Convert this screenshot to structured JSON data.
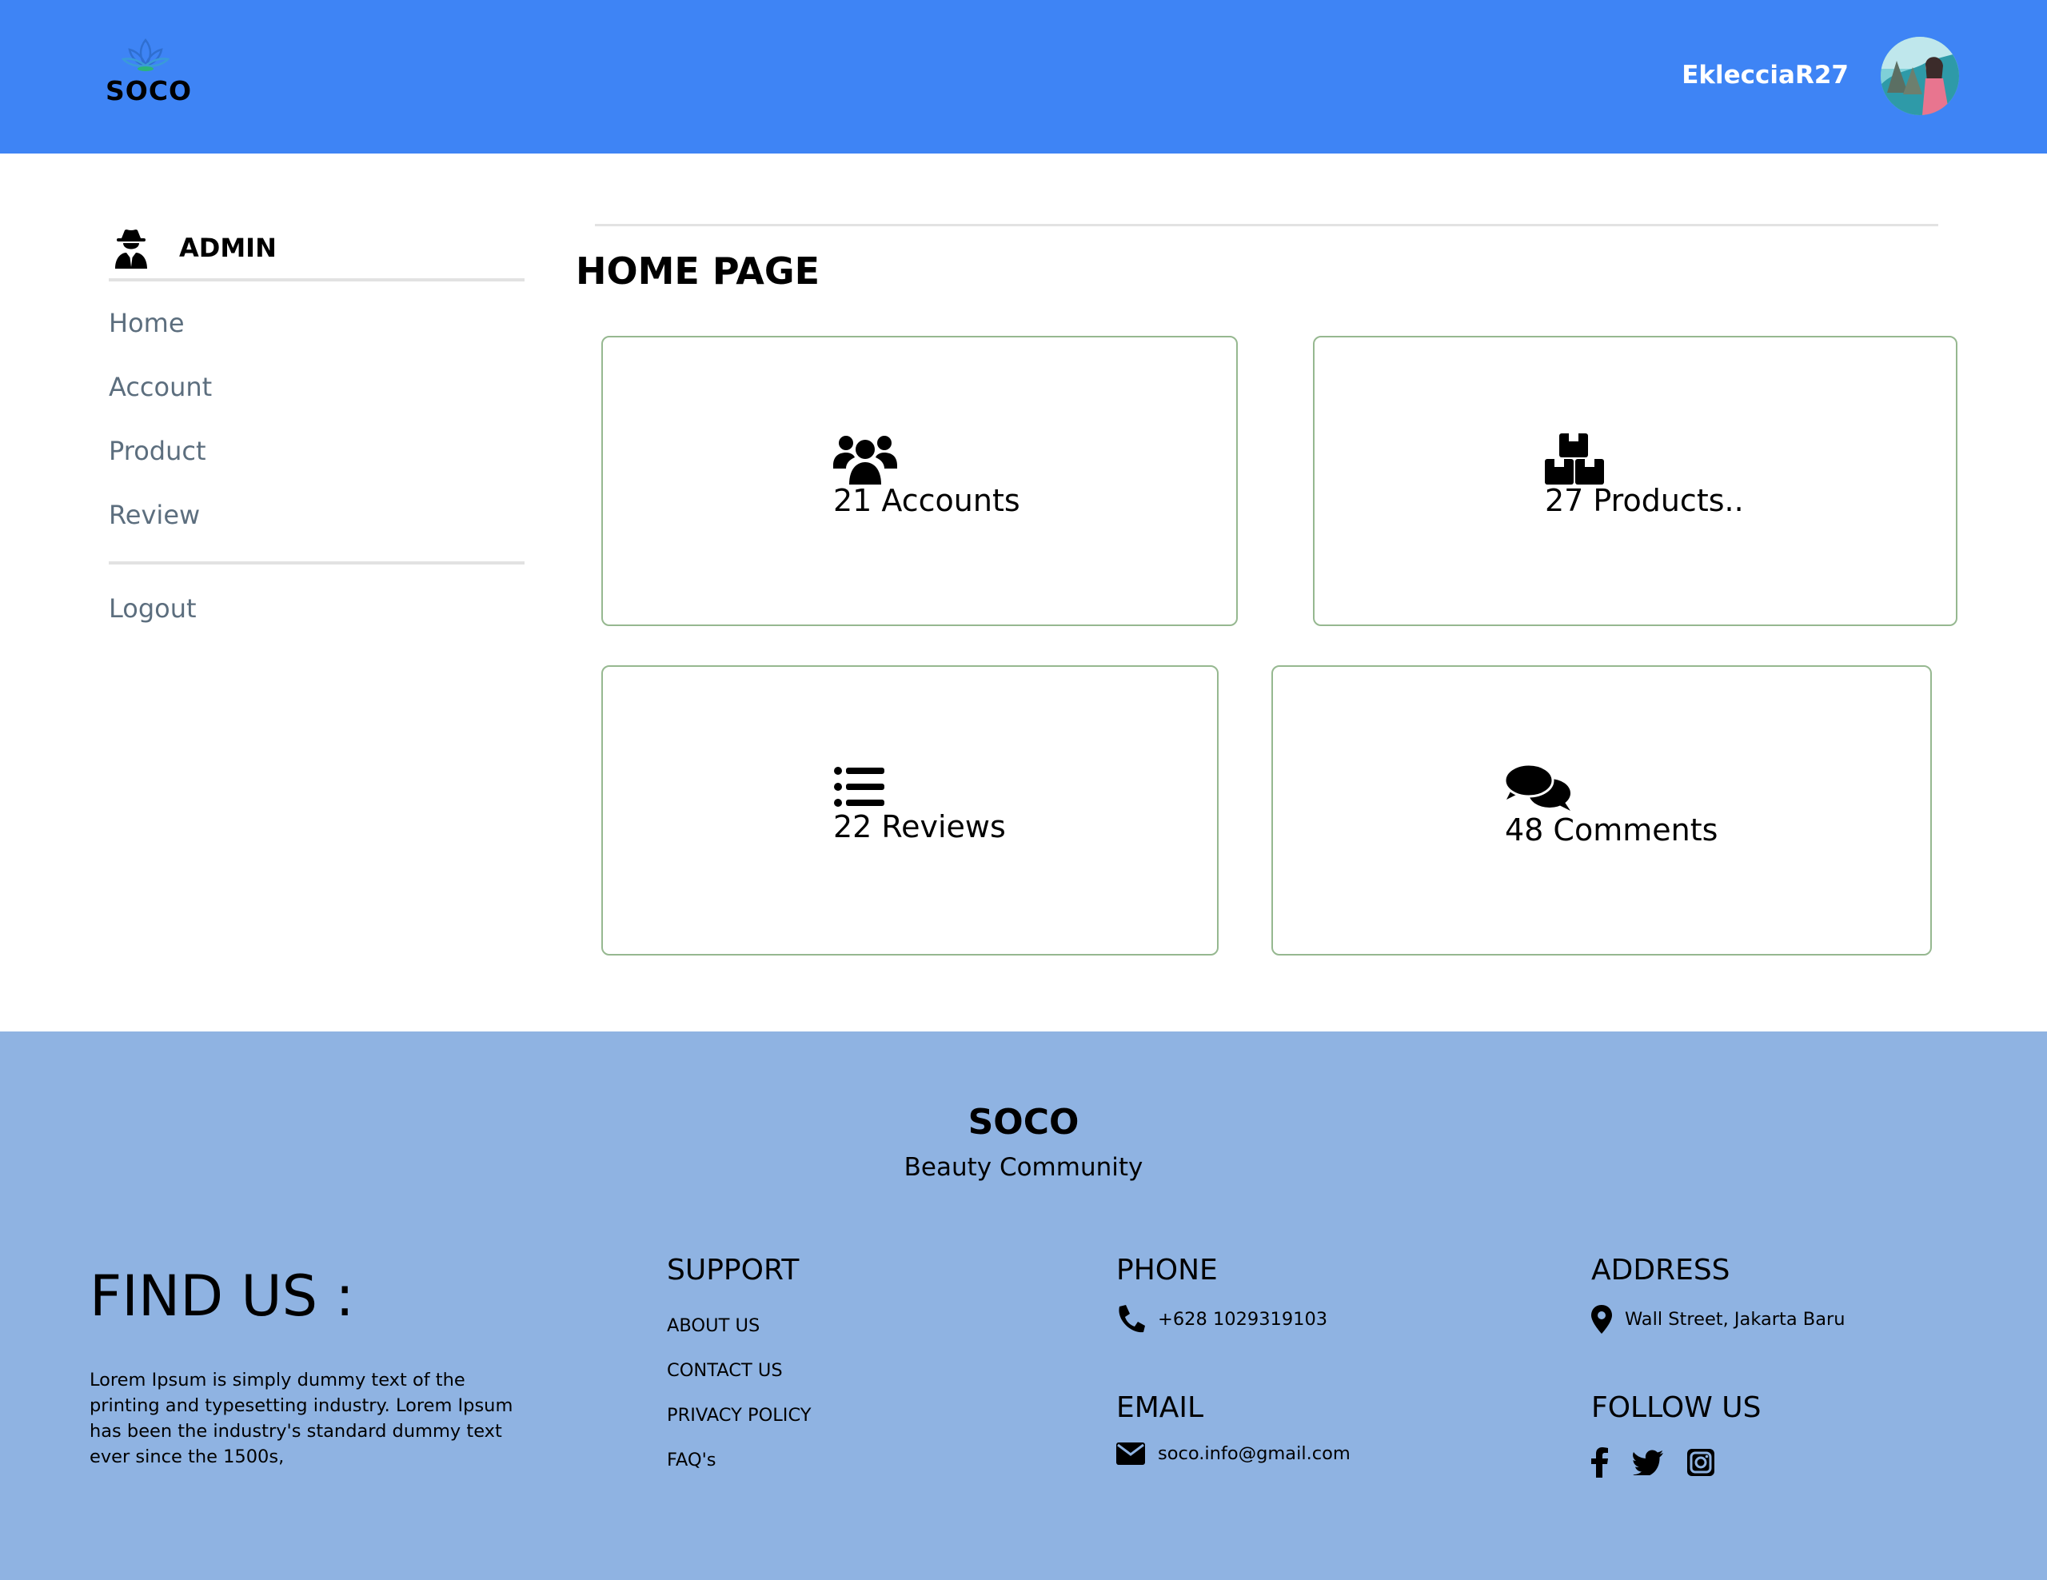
{
  "header": {
    "logo_text": "SOCO",
    "username": "EklecciaR27"
  },
  "sidebar": {
    "section_label": "ADMIN",
    "items": [
      {
        "label": "Home"
      },
      {
        "label": "Account"
      },
      {
        "label": "Product"
      },
      {
        "label": "Review"
      }
    ],
    "logout_label": "Logout"
  },
  "main": {
    "title": "HOME PAGE",
    "cards": [
      {
        "icon": "users-icon",
        "text": "21 Accounts"
      },
      {
        "icon": "boxes-icon",
        "text": "27 Products.."
      },
      {
        "icon": "list-icon",
        "text": "22 Reviews"
      },
      {
        "icon": "comments-icon",
        "text": "48 Comments"
      }
    ]
  },
  "footer": {
    "brand": "SOCO",
    "tagline": "Beauty Community",
    "find_us": "FIND US :",
    "description": "Lorem Ipsum is simply dummy text of the printing and typesetting industry. Lorem Ipsum has been the industry's standard dummy text ever since the 1500s,",
    "support_heading": "SUPPORT",
    "support_links": [
      "ABOUT US",
      "CONTACT US",
      "PRIVACY POLICY",
      "FAQ's"
    ],
    "phone_heading": "PHONE",
    "phone": "+628 1029319103",
    "email_heading": "EMAIL",
    "email": "soco.info@gmail.com",
    "address_heading": "ADDRESS",
    "address": "Wall Street, Jakarta Baru",
    "follow_heading": "FOLLOW US",
    "socials": [
      "facebook-icon",
      "twitter-icon",
      "instagram-icon"
    ]
  },
  "colors": {
    "header_bg": "#3e84f5",
    "footer_bg": "#8fb3e2",
    "card_border": "#96b890",
    "nav_text": "#5c6e7e"
  }
}
